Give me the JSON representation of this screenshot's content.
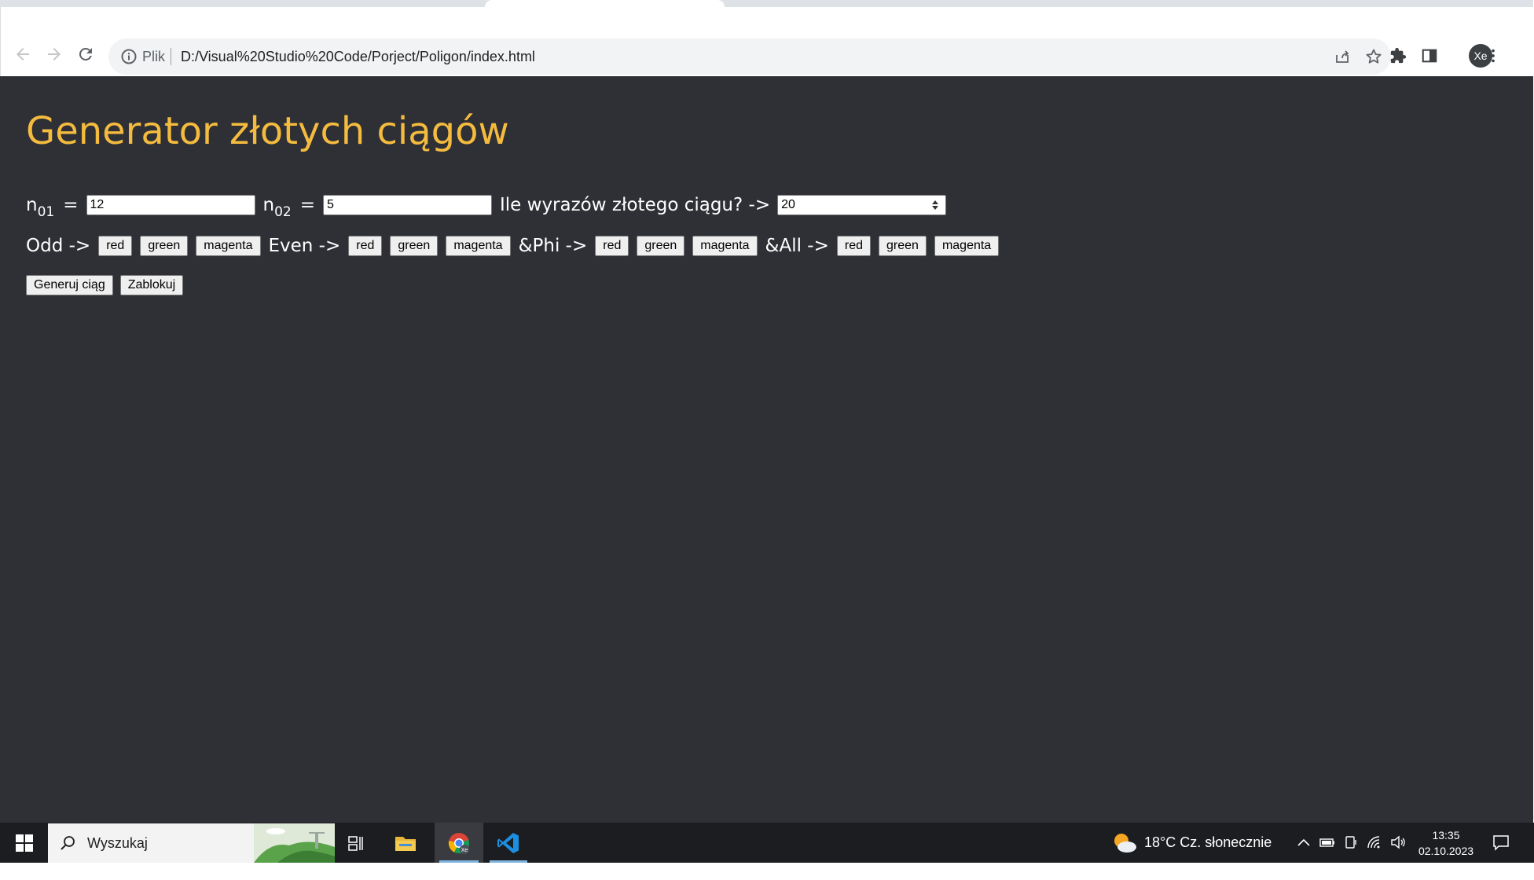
{
  "browser": {
    "omnibox_prefix": "Plik",
    "url": "D:/Visual%20Studio%20Code/Porject/Poligon/index.html",
    "avatar_initials": "Xe"
  },
  "page": {
    "title": "Generator złotych ciągów",
    "n01_label": "n",
    "n01_sub": "01",
    "n02_label": "n",
    "n02_sub": "02",
    "equals": "=",
    "n01_value": "12",
    "n02_value": "5",
    "count_label": "Ile wyrazów złotego ciągu? ->",
    "count_value": "20",
    "groups": [
      {
        "label": "Odd ->",
        "buttons": [
          "red",
          "green",
          "magenta"
        ]
      },
      {
        "label": "Even ->",
        "buttons": [
          "red",
          "green",
          "magenta"
        ]
      },
      {
        "label": "&Phi ->",
        "buttons": [
          "red",
          "green",
          "magenta"
        ]
      },
      {
        "label": "&All ->",
        "buttons": [
          "red",
          "green",
          "magenta"
        ]
      }
    ],
    "generate_label": "Generuj ciąg",
    "lock_label": "Zablokuj",
    "colors": {
      "background": "#2e3036",
      "title": "#f4bb3e",
      "text": "#ffffff"
    }
  },
  "taskbar": {
    "search_placeholder": "Wyszukaj",
    "weather": "18°C  Cz. słonecznie",
    "time": "13:35",
    "date": "02.10.2023",
    "pinned": [
      "task-view-icon",
      "file-explorer-icon",
      "chrome-icon",
      "vscode-icon"
    ]
  }
}
